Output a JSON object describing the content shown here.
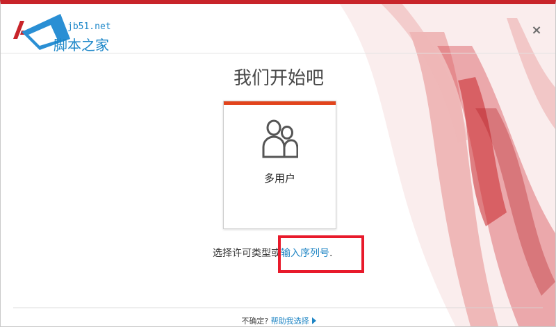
{
  "header": {
    "watermark_site": "jb51.net",
    "watermark_name": "脚本之家"
  },
  "title": "我们开始吧",
  "card": {
    "label": "多用户",
    "icon": "users-icon",
    "accent": "#e2441c"
  },
  "instruction": {
    "prefix": "选择许可类型或",
    "link": "输入序列号",
    "suffix": "."
  },
  "footer": {
    "question": "不确定?",
    "help_link": "帮助我选择"
  },
  "colors": {
    "brand_red": "#c8242a",
    "link_blue": "#1f85c4",
    "highlight": "#e81a2b"
  }
}
